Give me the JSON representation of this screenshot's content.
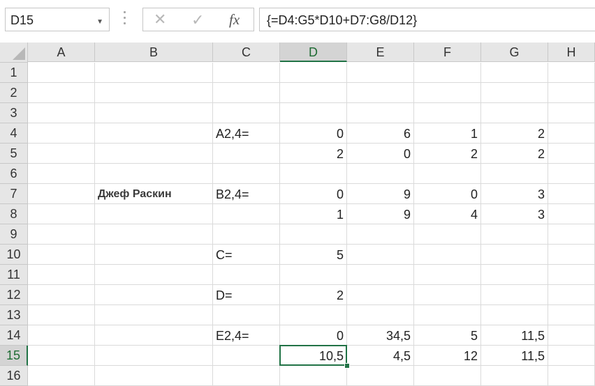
{
  "name_box": {
    "value": "D15"
  },
  "formula_bar": {
    "cancel_icon": "✕",
    "enter_icon": "✓",
    "fx_icon": "fx",
    "value": "{=D4:G5*D10+D7:G8/D12}"
  },
  "columns": [
    "A",
    "B",
    "C",
    "D",
    "E",
    "F",
    "G",
    "H"
  ],
  "selected_column": "D",
  "selected_row": 15,
  "rows": [
    {
      "row": 1,
      "cells": {}
    },
    {
      "row": 2,
      "cells": {}
    },
    {
      "row": 3,
      "cells": {}
    },
    {
      "row": 4,
      "cells": {
        "C": "A2,4=",
        "D": "0",
        "E": "6",
        "F": "1",
        "G": "2"
      }
    },
    {
      "row": 5,
      "cells": {
        "D": "2",
        "E": "0",
        "F": "2",
        "G": "2"
      }
    },
    {
      "row": 6,
      "cells": {}
    },
    {
      "row": 7,
      "cells": {
        "B": "Джеф Раскин",
        "C": "B2,4=",
        "D": "0",
        "E": "9",
        "F": "0",
        "G": "3"
      }
    },
    {
      "row": 8,
      "cells": {
        "D": "1",
        "E": "9",
        "F": "4",
        "G": "3"
      }
    },
    {
      "row": 9,
      "cells": {}
    },
    {
      "row": 10,
      "cells": {
        "C": "C=",
        "D": "5"
      }
    },
    {
      "row": 11,
      "cells": {}
    },
    {
      "row": 12,
      "cells": {
        "C": "D=",
        "D": "2"
      }
    },
    {
      "row": 13,
      "cells": {}
    },
    {
      "row": 14,
      "cells": {
        "C": "E2,4=",
        "D": "0",
        "E": "34,5",
        "F": "5",
        "G": "11,5"
      }
    },
    {
      "row": 15,
      "cells": {
        "D": "10,5",
        "E": "4,5",
        "F": "12",
        "G": "11,5"
      }
    },
    {
      "row": 16,
      "cells": {}
    }
  ]
}
